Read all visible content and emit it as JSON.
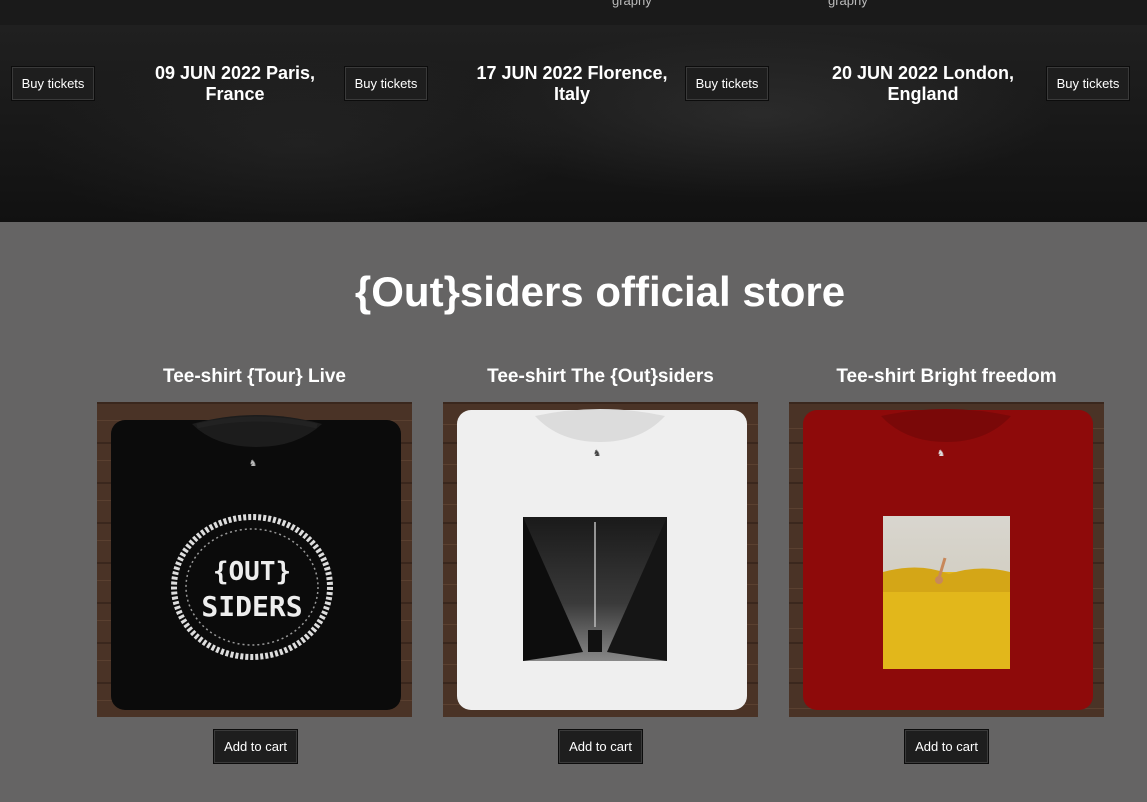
{
  "nav": {
    "crumb_left": "graphy",
    "crumb_right": "graphy"
  },
  "tour": {
    "buy_label": "Buy tickets",
    "dates": [
      {
        "date": "09 JUN 2022 Paris, France"
      },
      {
        "date": "17 JUN 2022 Florence, Italy"
      },
      {
        "date": "20 JUN 2022 London, England"
      }
    ]
  },
  "store": {
    "title": "{Out}siders official store",
    "add_to_cart_label": "Add to cart",
    "products": [
      {
        "name": "Tee-shirt {Tour} Live",
        "shirt_color": "#0b0b0b",
        "print_text_top": "{OUT}",
        "print_text_bottom": "SIDERS"
      },
      {
        "name": "Tee-shirt The {Out}siders",
        "shirt_color": "#f1f1f1"
      },
      {
        "name": "Tee-shirt Bright freedom",
        "shirt_color": "#8e0a0a"
      }
    ]
  },
  "colors": {
    "page_bg": "#656464",
    "tour_bg": "#181818",
    "button_bg": "#1e1e1e",
    "wood": "#4a3326"
  }
}
